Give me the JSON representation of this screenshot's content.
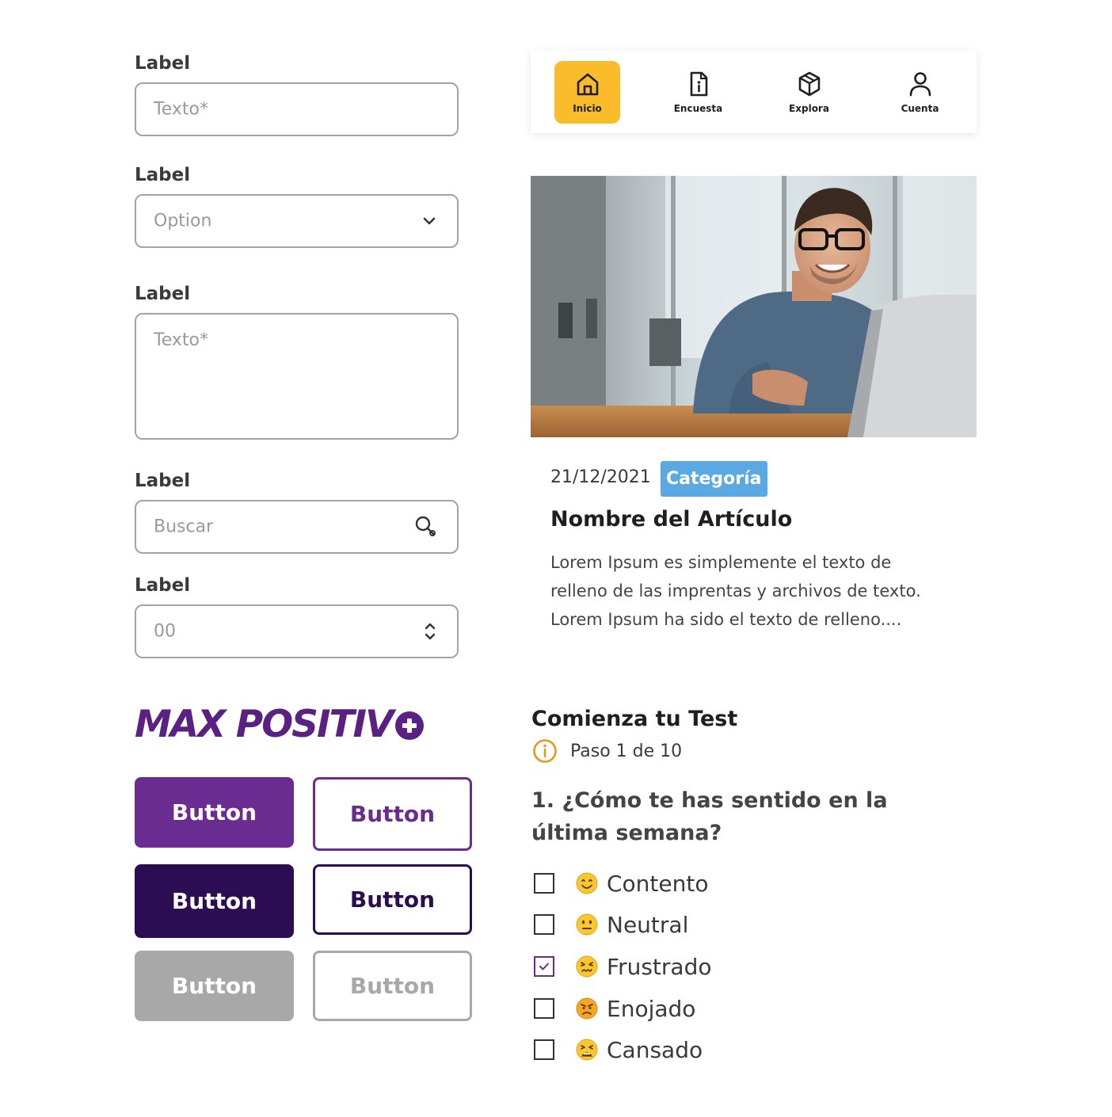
{
  "form": {
    "text_field": {
      "label": "Label",
      "placeholder": "Texto*"
    },
    "select_field": {
      "label": "Label",
      "placeholder": "Option"
    },
    "textarea_field": {
      "label": "Label",
      "placeholder": "Texto*"
    },
    "search_field": {
      "label": "Label",
      "placeholder": "Buscar"
    },
    "number_field": {
      "label": "Label",
      "placeholder": "00"
    }
  },
  "logo": {
    "text": "MAX POSITIV"
  },
  "buttons": {
    "primary": "Button",
    "primary_outline": "Button",
    "dark": "Button",
    "dark_outline": "Button",
    "disabled": "Button",
    "disabled_outline": "Button"
  },
  "nav": {
    "items": [
      {
        "label": "Inicio",
        "icon": "home-icon",
        "active": true
      },
      {
        "label": "Encuesta",
        "icon": "document-info-icon",
        "active": false
      },
      {
        "label": "Explora",
        "icon": "cube-icon",
        "active": false
      },
      {
        "label": "Cuenta",
        "icon": "user-icon",
        "active": false
      }
    ]
  },
  "article": {
    "date": "21/12/2021",
    "category": "Categoría",
    "title": "Nombre del Artículo",
    "body_lines": [
      "Lorem Ipsum es simplemente el texto de",
      "relleno de las imprentas y archivos de texto.",
      "Lorem Ipsum ha sido el texto de relleno...."
    ]
  },
  "test": {
    "title": "Comienza tu Test",
    "step": "Paso 1 de 10",
    "question_lines": [
      "1. ¿Cómo te has sentido en la",
      "última semana?"
    ],
    "options": [
      {
        "label": "Contento",
        "emoji": "smiling-face-icon",
        "checked": false
      },
      {
        "label": "Neutral",
        "emoji": "neutral-face-icon",
        "checked": false
      },
      {
        "label": "Frustrado",
        "emoji": "frustrated-face-icon",
        "checked": true
      },
      {
        "label": "Enojado",
        "emoji": "angry-face-icon",
        "checked": false
      },
      {
        "label": "Cansado",
        "emoji": "tired-face-icon",
        "checked": false
      }
    ]
  },
  "colors": {
    "brand_purple": "#6b2c91",
    "brand_dark": "#2c0d54",
    "nav_active": "#fbbc2c",
    "badge": "#5aa9e2"
  }
}
